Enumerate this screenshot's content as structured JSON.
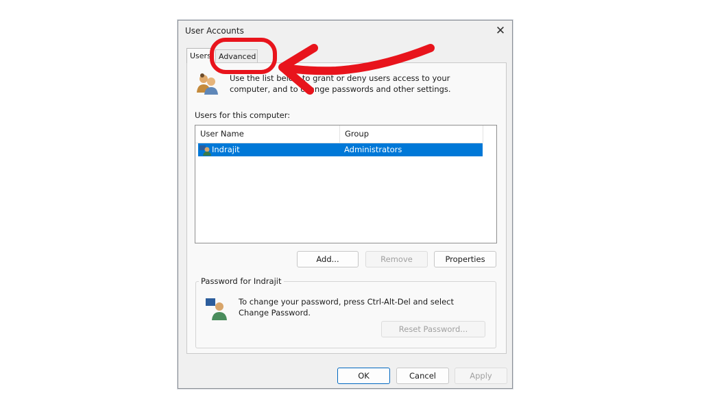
{
  "window": {
    "title": "User Accounts",
    "close_glyph": "✕"
  },
  "tabs": [
    {
      "label": "Users",
      "active": true
    },
    {
      "label": "Advanced",
      "active": false
    }
  ],
  "intro_text": "Use the list below to grant or deny users access to your computer, and to change passwords and other settings.",
  "users_label": "Users for this computer:",
  "columns": [
    "User Name",
    "Group"
  ],
  "users": [
    {
      "name": "Indrajit",
      "group": "Administrators",
      "selected": true
    }
  ],
  "buttons": {
    "add": "Add...",
    "remove": "Remove",
    "properties": "Properties",
    "reset_password": "Reset Password...",
    "ok": "OK",
    "cancel": "Cancel",
    "apply": "Apply"
  },
  "password_group": {
    "label": "Password for Indrajit",
    "text": "To change your password, press Ctrl-Alt-Del and select Change Password."
  },
  "icons": {
    "users": "users-icon",
    "user": "user-icon",
    "password_user": "user-key-icon"
  },
  "colors": {
    "selection": "#0078d7",
    "annotation": "#e8141c"
  }
}
